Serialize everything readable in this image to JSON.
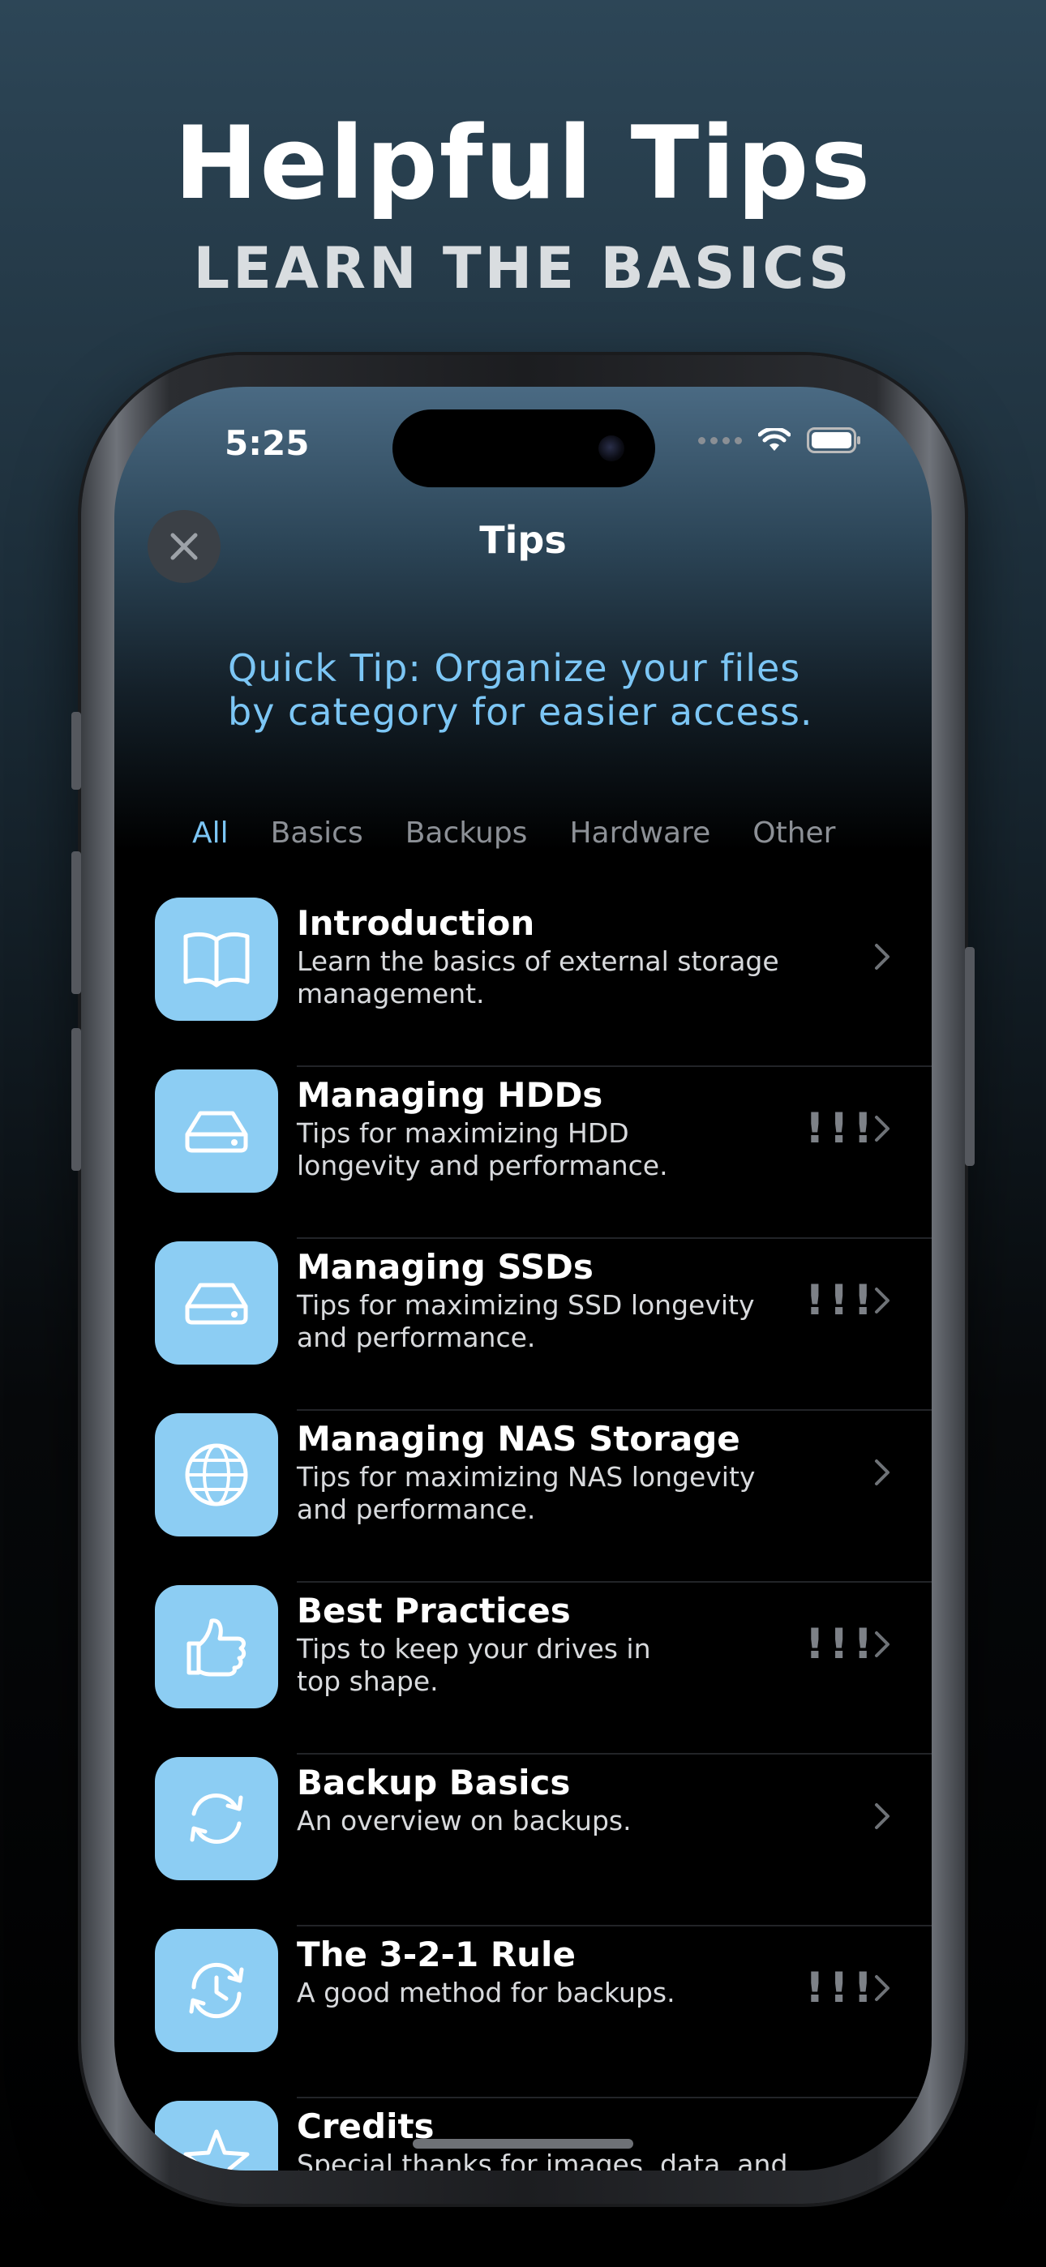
{
  "promo": {
    "headline": "Helpful Tips",
    "subheadline": "LEARN THE BASICS"
  },
  "status_bar": {
    "time": "5:25"
  },
  "nav": {
    "title": "Tips"
  },
  "quick_tip": {
    "line1": "Quick Tip: Organize your files",
    "line2": "by category for easier access."
  },
  "tabs": [
    {
      "label": "All",
      "selected": true
    },
    {
      "label": "Basics",
      "selected": false
    },
    {
      "label": "Backups",
      "selected": false
    },
    {
      "label": "Hardware",
      "selected": false
    },
    {
      "label": "Other",
      "selected": false
    }
  ],
  "tips": [
    {
      "title": "Introduction",
      "desc1": "Learn the basics of external storage",
      "desc2": "management.",
      "icon": "book-icon",
      "priority": ""
    },
    {
      "title": "Managing HDDs",
      "desc1": "Tips for maximizing HDD",
      "desc2": "longevity and performance.",
      "icon": "drive-icon",
      "priority": "!!!"
    },
    {
      "title": "Managing SSDs",
      "desc1": "Tips for maximizing SSD longevity",
      "desc2": "and performance.",
      "icon": "drive-icon",
      "priority": "!!!"
    },
    {
      "title": "Managing NAS Storage",
      "desc1": "Tips for maximizing NAS longevity",
      "desc2": "and performance.",
      "icon": "globe-icon",
      "priority": ""
    },
    {
      "title": "Best Practices",
      "desc1": "Tips to keep your drives in",
      "desc2": "top shape.",
      "icon": "thumbs-up-icon",
      "priority": "!!!"
    },
    {
      "title": "Backup Basics",
      "desc1": "An overview on backups.",
      "desc2": "",
      "icon": "sync-arrows-icon",
      "priority": ""
    },
    {
      "title": "The 3-2-1 Rule",
      "desc1": "A good method for backups.",
      "desc2": "",
      "icon": "clock-arrows-icon",
      "priority": "!!!"
    },
    {
      "title": "Credits",
      "desc1": "Special thanks for images, data, and",
      "desc2": "",
      "icon": "star-icon",
      "priority": ""
    }
  ],
  "colors": {
    "accent": "#7cc6f5",
    "icon_tile": "#8ccdf3"
  }
}
